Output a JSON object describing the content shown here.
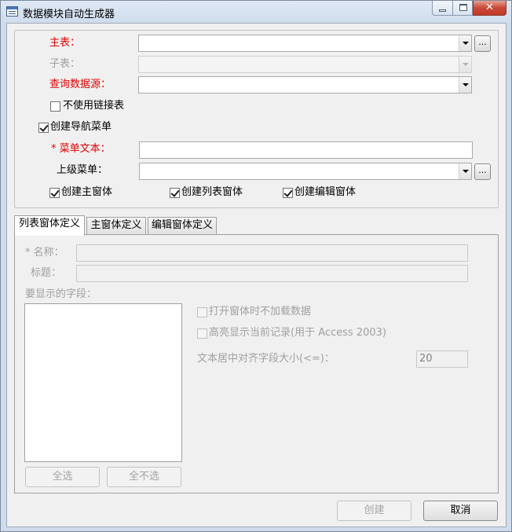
{
  "window": {
    "title": "数据模块自动生成器",
    "close_glyph": "✕"
  },
  "top": {
    "main_table_label": "主表：",
    "main_table_value": "",
    "sub_table_label": "子表：",
    "sub_table_value": "",
    "query_source_label": "查询数据源：",
    "query_source_value": "",
    "browse_label": "...",
    "no_linked_table_label": "不使用链接表",
    "no_linked_table_checked": false,
    "create_nav_menu_label": "创建导航菜单",
    "create_nav_menu_checked": true,
    "menu_text_label": "* 菜单文本：",
    "menu_text_value": "",
    "parent_menu_label": "上级菜单：",
    "parent_menu_value": "",
    "create_main_form_label": "创建主窗体",
    "create_main_form_checked": true,
    "create_list_form_label": "创建列表窗体",
    "create_list_form_checked": true,
    "create_edit_form_label": "创建编辑窗体",
    "create_edit_form_checked": true
  },
  "tabs": [
    {
      "label": "列表窗体定义",
      "active": true
    },
    {
      "label": "主窗体定义",
      "active": false
    },
    {
      "label": "编辑窗体定义",
      "active": false
    }
  ],
  "list_tab": {
    "name_label": "* 名称：",
    "name_value": "",
    "caption_label": "标题：",
    "caption_value": "",
    "fields_label": "要显示的字段：",
    "no_load_on_open_label": "打开窗体时不加载数据",
    "highlight_current_label": "高亮显示当前记录(用于 Access 2003)",
    "center_align_label": "文本居中对齐字段大小(<=)：",
    "center_align_value": "20",
    "select_all_label": "全选",
    "select_none_label": "全不选"
  },
  "footer": {
    "create_label": "创建",
    "cancel_label": "取消"
  }
}
